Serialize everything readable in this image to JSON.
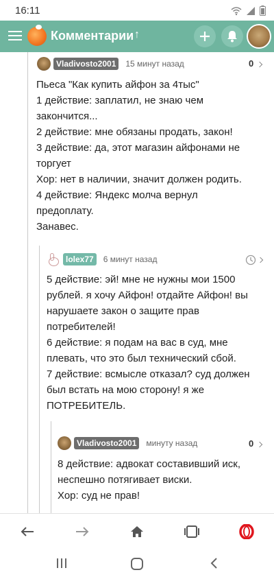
{
  "status": {
    "time": "16:11"
  },
  "appbar": {
    "title": "Комментарии",
    "arrow": "↑"
  },
  "comments": [
    {
      "user": "Vladivosto2001",
      "time": "15 минут назад",
      "score": "0",
      "lines": [
        "Пьеса \"Как купить айфон за 4тыс\"",
        "1 действие: заплатил, не знаю чем",
        "закончится...",
        "2 действие: мне обязаны продать, закон!",
        "3 действие: да, этот магазин айфонами не",
        "торгует",
        "Хор: нет в наличии, значит должен родить.",
        "4 действие: Яндекс молча вернул",
        "предоплату.",
        "Занавес."
      ]
    },
    {
      "user": "lolex77",
      "time": "6 минут назад",
      "lines": [
        "5 действие: эй! мне не нужны мои 1500",
        "рублей. я хочу Айфон! отдайте Айфон! вы",
        "нарушаете закон о защите прав",
        "потребителей!",
        "6 действие: я подам на вас в суд, мне",
        "плевать, что это был технический сбой.",
        "7 действие: всмысле отказал? суд должен",
        "был встать на мою сторону! я же",
        "ПОТРЕБИТЕЛЬ."
      ]
    },
    {
      "user": "Vladivosto2001",
      "time": "минуту назад",
      "score": "0",
      "lines": [
        "8 действие: адвокат составивший иск,",
        "неспешно потягивает виски.",
        "Хор: суд не прав!"
      ]
    }
  ],
  "icons": {
    "menu": "hamburger-icon",
    "add": "plus-icon",
    "bell": "bell-icon",
    "clock": "clock-icon",
    "back": "arrow-left-icon",
    "forward": "arrow-right-icon",
    "home": "home-icon",
    "tabs": "tabs-icon",
    "opera": "opera-icon"
  },
  "colors": {
    "appbar": "#6fb59f",
    "teal_badge": "#74b9a8",
    "opera": "#e0161e"
  }
}
